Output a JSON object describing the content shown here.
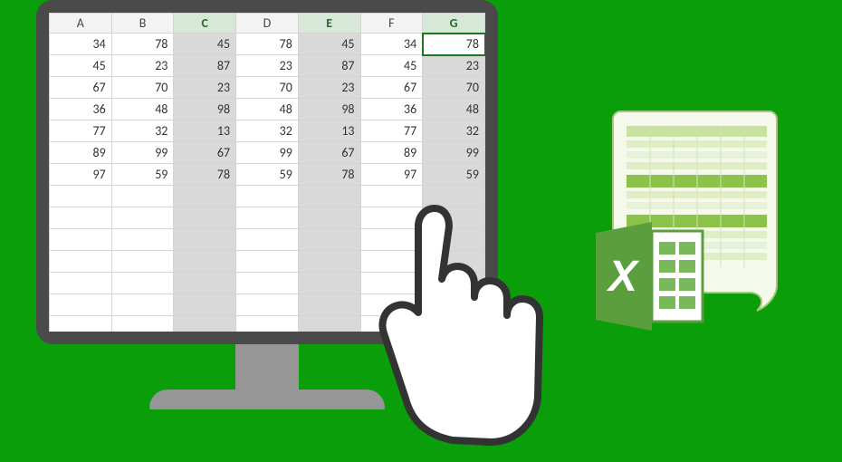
{
  "spreadsheet": {
    "columns": [
      "A",
      "B",
      "C",
      "D",
      "E",
      "F",
      "G"
    ],
    "selected_columns": [
      "C",
      "E",
      "G"
    ],
    "active_cell": {
      "col": "G",
      "row": 0
    },
    "rows": [
      {
        "A": 34,
        "B": 78,
        "C": 45,
        "D": 78,
        "E": 45,
        "F": 34,
        "G": 78
      },
      {
        "A": 45,
        "B": 23,
        "C": 87,
        "D": 23,
        "E": 87,
        "F": 45,
        "G": 23
      },
      {
        "A": 67,
        "B": 70,
        "C": 23,
        "D": 70,
        "E": 23,
        "F": 67,
        "G": 70
      },
      {
        "A": 36,
        "B": 48,
        "C": 98,
        "D": 48,
        "E": 98,
        "F": 36,
        "G": 48
      },
      {
        "A": 77,
        "B": 32,
        "C": 13,
        "D": 32,
        "E": 13,
        "F": 77,
        "G": 32
      },
      {
        "A": 89,
        "B": 99,
        "C": 67,
        "D": 99,
        "E": 67,
        "F": 89,
        "G": 99
      },
      {
        "A": 97,
        "B": 59,
        "C": 78,
        "D": 59,
        "E": 78,
        "F": 97,
        "G": 59
      }
    ],
    "blank_rows": 7
  },
  "icon": {
    "logo_letter": "X"
  }
}
